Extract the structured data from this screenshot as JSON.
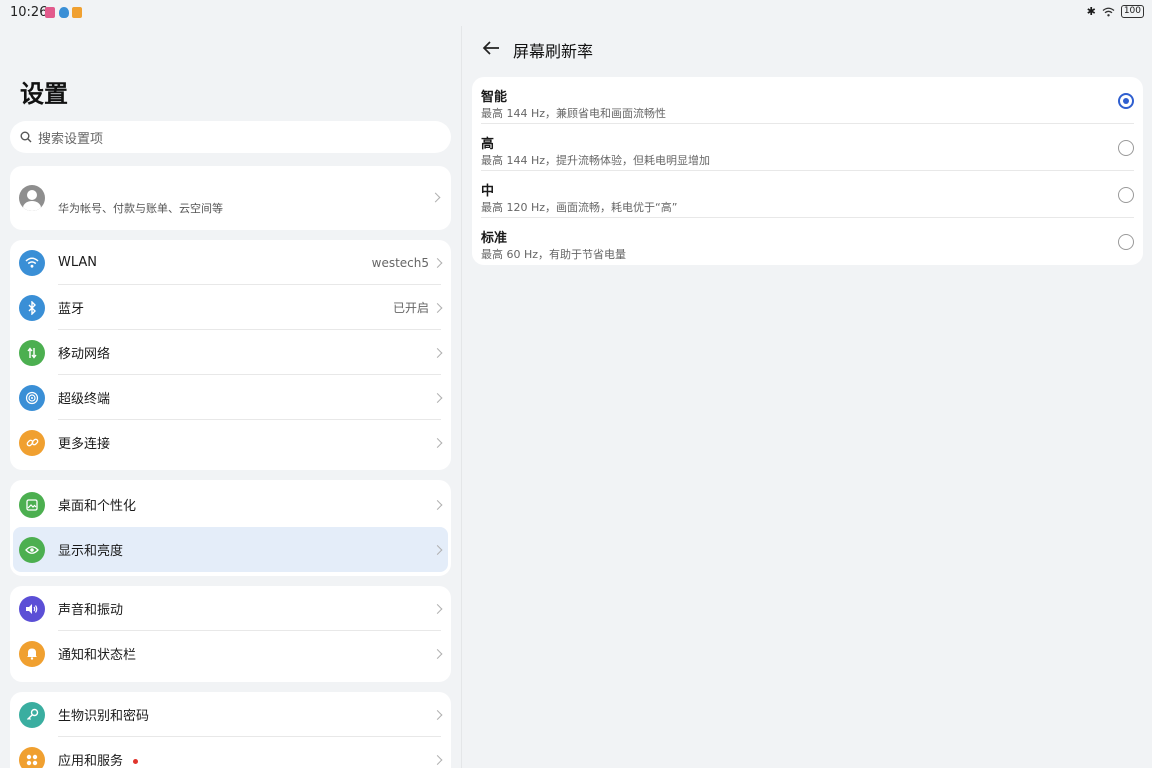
{
  "status": {
    "time": "10:26",
    "battery": "100"
  },
  "left": {
    "title": "设置",
    "search_placeholder": "搜索设置项",
    "account": {
      "subtitle": "华为帐号、付款与账单、云空间等"
    },
    "group1": [
      {
        "label": "WLAN",
        "value": "westech5",
        "icon": "wifi-icon",
        "color": "#3a8fd6"
      },
      {
        "label": "蓝牙",
        "value": "已开启",
        "icon": "bluetooth-icon",
        "color": "#3a8fd6"
      },
      {
        "label": "移动网络",
        "value": "",
        "icon": "mobile-data-icon",
        "color": "#4caf50"
      },
      {
        "label": "超级终端",
        "value": "",
        "icon": "super-device-icon",
        "color": "#3a8fd6"
      },
      {
        "label": "更多连接",
        "value": "",
        "icon": "link-icon",
        "color": "#f0a030"
      }
    ],
    "group2": [
      {
        "label": "桌面和个性化",
        "icon": "wallpaper-icon",
        "color": "#4caf50"
      },
      {
        "label": "显示和亮度",
        "icon": "eye-icon",
        "color": "#4caf50"
      }
    ],
    "group3": [
      {
        "label": "声音和振动",
        "icon": "speaker-icon",
        "color": "#5b4fd6"
      },
      {
        "label": "通知和状态栏",
        "icon": "bell-icon",
        "color": "#f0a030"
      }
    ],
    "group4": [
      {
        "label": "生物识别和密码",
        "icon": "key-icon",
        "color": "#3aaea0"
      },
      {
        "label": "应用和服务",
        "icon": "apps-icon",
        "color": "#f0a030"
      }
    ]
  },
  "right": {
    "title": "屏幕刷新率",
    "options": [
      {
        "title": "智能",
        "desc": "最高 144 Hz，兼顾省电和画面流畅性",
        "selected": true
      },
      {
        "title": "高",
        "desc": "最高 144 Hz，提升流畅体验，但耗电明显增加",
        "selected": false
      },
      {
        "title": "中",
        "desc": "最高 120 Hz，画面流畅，耗电优于“高”",
        "selected": false
      },
      {
        "title": "标准",
        "desc": "最高 60 Hz，有助于节省电量",
        "selected": false
      }
    ]
  }
}
